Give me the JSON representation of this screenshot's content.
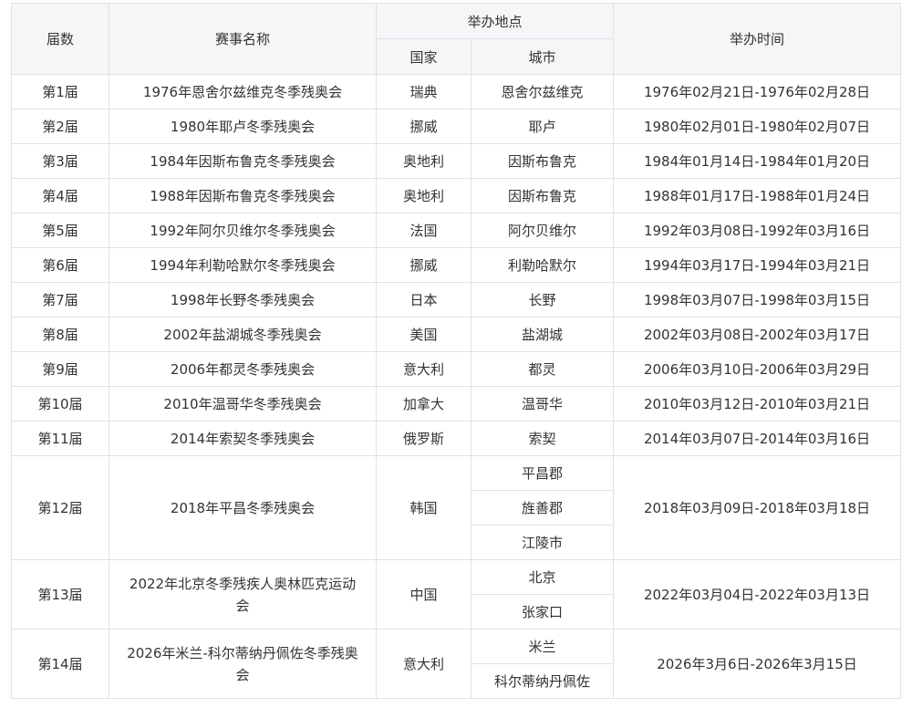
{
  "header": {
    "session": "届数",
    "name": "赛事名称",
    "location": "举办地点",
    "country": "国家",
    "city": "城市",
    "time": "举办时间"
  },
  "rows": [
    {
      "session": "第1届",
      "name": "1976年恩舍尔兹维克冬季残奥会",
      "country": "瑞典",
      "cities": [
        "恩舍尔兹维克"
      ],
      "time": "1976年02月21日-1976年02月28日"
    },
    {
      "session": "第2届",
      "name": "1980年耶卢冬季残奥会",
      "country": "挪威",
      "cities": [
        "耶卢"
      ],
      "time": "1980年02月01日-1980年02月07日"
    },
    {
      "session": "第3届",
      "name": "1984年因斯布鲁克冬季残奥会",
      "country": "奥地利",
      "cities": [
        "因斯布鲁克"
      ],
      "time": "1984年01月14日-1984年01月20日"
    },
    {
      "session": "第4届",
      "name": "1988年因斯布鲁克冬季残奥会",
      "country": "奥地利",
      "cities": [
        "因斯布鲁克"
      ],
      "time": "1988年01月17日-1988年01月24日"
    },
    {
      "session": "第5届",
      "name": "1992年阿尔贝维尔冬季残奥会",
      "country": "法国",
      "cities": [
        "阿尔贝维尔"
      ],
      "time": "1992年03月08日-1992年03月16日"
    },
    {
      "session": "第6届",
      "name": "1994年利勒哈默尔冬季残奥会",
      "country": "挪威",
      "cities": [
        "利勒哈默尔"
      ],
      "time": "1994年03月17日-1994年03月21日"
    },
    {
      "session": "第7届",
      "name": "1998年长野冬季残奥会",
      "country": "日本",
      "cities": [
        "长野"
      ],
      "time": "1998年03月07日-1998年03月15日"
    },
    {
      "session": "第8届",
      "name": "2002年盐湖城冬季残奥会",
      "country": "美国",
      "cities": [
        "盐湖城"
      ],
      "time": "2002年03月08日-2002年03月17日"
    },
    {
      "session": "第9届",
      "name": "2006年都灵冬季残奥会",
      "country": "意大利",
      "cities": [
        "都灵"
      ],
      "time": "2006年03月10日-2006年03月29日"
    },
    {
      "session": "第10届",
      "name": "2010年温哥华冬季残奥会",
      "country": "加拿大",
      "cities": [
        "温哥华"
      ],
      "time": "2010年03月12日-2010年03月21日"
    },
    {
      "session": "第11届",
      "name": "2014年索契冬季残奥会",
      "country": "俄罗斯",
      "cities": [
        "索契"
      ],
      "time": "2014年03月07日-2014年03月16日"
    },
    {
      "session": "第12届",
      "name": "2018年平昌冬季残奥会",
      "country": "韩国",
      "cities": [
        "平昌郡",
        "旌善郡",
        "江陵市"
      ],
      "time": "2018年03月09日-2018年03月18日"
    },
    {
      "session": "第13届",
      "name_lines": [
        "2022年北京冬季残疾人奥林匹克运动",
        "会"
      ],
      "country": "中国",
      "cities": [
        "北京",
        "张家口"
      ],
      "time": "2022年03月04日-2022年03月13日"
    },
    {
      "session": "第14届",
      "name_lines": [
        "2026年米兰-科尔蒂纳丹佩佐冬季残奥",
        "会"
      ],
      "country": "意大利",
      "cities": [
        "米兰",
        "科尔蒂纳丹佩佐"
      ],
      "time": "2026年3月6日-2026年3月15日"
    }
  ]
}
